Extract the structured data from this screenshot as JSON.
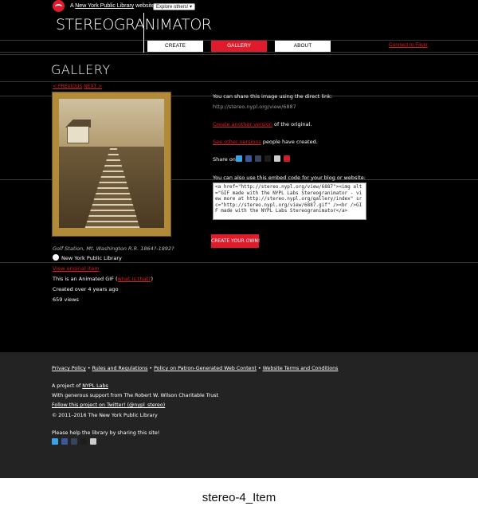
{
  "topbar": {
    "prefix": "A",
    "library_link": "New York Public Library",
    "suffix": "website",
    "explore_label": "Explore others! ▾"
  },
  "header": {
    "logo": "STEREOGRANIMATOR",
    "nav": [
      "CREATE",
      "GALLERY",
      "ABOUT"
    ],
    "connect_label": "Connect to Flickr"
  },
  "page": {
    "title": "GALLERY",
    "prev_label": "< PREVIOUS",
    "next_label": "NEXT >"
  },
  "item": {
    "title": "Golf Station, Mt. Washington R.R. 1864?-1892?",
    "library": "New York Public Library",
    "view_original": "View original item",
    "animated_prefix": "This is an Animated GIF (",
    "what_is_that": "what is that?",
    "animated_suffix": ")",
    "created": "Created over 4 years ago",
    "views": "659 views"
  },
  "share": {
    "direct_link_label": "You can share this image using the direct link:",
    "direct_link": "http://stereo.nypl.org/view/6887",
    "create_another_link": "Create another version",
    "create_another_suffix": " of the original.",
    "see_other_link": "See other versions",
    "see_other_suffix": " people have created.",
    "share_on": "Share on:",
    "embed_label": "You can also use this embed code for your blog or website:",
    "embed_code": "<a href=\"http://stereo.nypl.org/view/6887\"><img alt=\"GIF made with the NYPL Labs Stereogranimator - view more at http://stereo.nypl.org/gallery/index\" src=\"http://stereo.nypl.org/view/6887.gif\" /><br />GIF made with the NYPL Labs Stereogranimator</a>",
    "create_own": "CREATE YOUR OWN!"
  },
  "share_icons": [
    {
      "name": "twitter-icon",
      "color": "#3aa3e3"
    },
    {
      "name": "facebook-icon",
      "color": "#3b5998"
    },
    {
      "name": "tumblr-icon",
      "color": "#35465c"
    },
    {
      "name": "digg-icon",
      "color": "#1d1d1d"
    },
    {
      "name": "email-icon",
      "color": "#cccccc"
    },
    {
      "name": "pinterest-icon",
      "color": "#cb2027"
    }
  ],
  "footer": {
    "links": [
      "Privacy Policy",
      "Rules and Regulations",
      "Policy on Patron-Generated Web Content",
      "Website Terms and Conditions"
    ],
    "separator": " • ",
    "project_prefix": "A project of ",
    "project_link": "NYPL Labs",
    "support": "With generous support from The Robert W. Wilson Charitable Trust",
    "twitter": "Follow this project on Twitter! (@nypl_stereo)",
    "copyright": "© 2011–2016 The New York Public Library",
    "help": "Please help the library by sharing this site!"
  },
  "footer_icons": [
    {
      "name": "twitter-icon",
      "color": "#3aa3e3"
    },
    {
      "name": "facebook-icon",
      "color": "#3b5998"
    },
    {
      "name": "tumblr-icon",
      "color": "#35465c"
    },
    {
      "name": "digg-icon",
      "color": "#1d1d1d"
    },
    {
      "name": "email-icon",
      "color": "#cccccc"
    }
  ],
  "caption": "stereo-4_Item",
  "colors": {
    "accent": "#e01b2b",
    "background": "#000000",
    "footer": "#232323"
  }
}
